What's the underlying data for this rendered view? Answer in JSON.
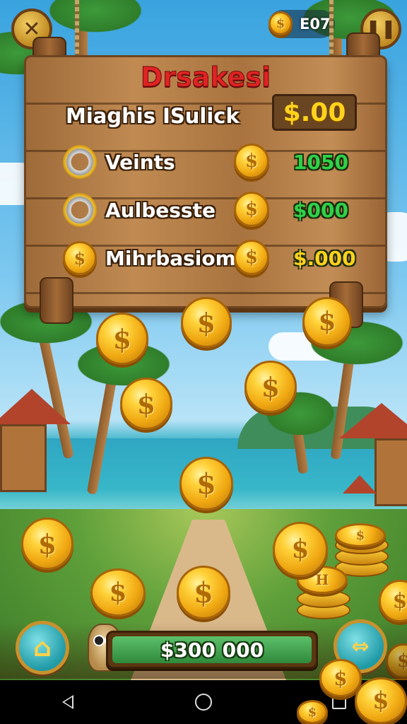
{
  "top_bar": {
    "close_icon": "close-x-icon",
    "coin_counter_value": "E07",
    "pause_icon": "pause-icon"
  },
  "board": {
    "title": "Drsakesi",
    "subtitle": "Miaghis ISulick",
    "balance": "$.00",
    "rows": [
      {
        "label": "Veints",
        "value": "1050",
        "value_color": "#2fd24a",
        "icon": "ring-icon"
      },
      {
        "label": "Aulbesste",
        "value": "$000",
        "value_color": "#2fd24a",
        "icon": "ring-icon"
      },
      {
        "label": "Mihrbasiom",
        "value": "$.000",
        "value_color": "#ffd21c",
        "icon": "medal-icon"
      }
    ]
  },
  "coin_symbol": "$",
  "bottom_bar": {
    "home_icon": "home-icon",
    "total": "$300 000",
    "arrow_icon": "left-right-arrow-icon"
  },
  "colors": {
    "title_red": "#e02323",
    "balance_yellow": "#ffd21c",
    "value_green": "#2fd24a",
    "total_bar_green": "#3ca84a",
    "wood": "#b37c45"
  },
  "system_nav": {
    "back_icon": "back-icon",
    "home_icon": "home-circle-icon",
    "recents_icon": "recents-icon"
  }
}
